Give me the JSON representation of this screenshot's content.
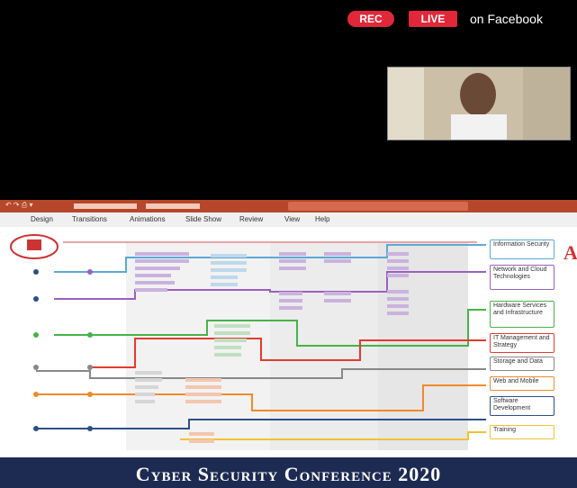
{
  "stream": {
    "rec_label": "REC",
    "live_label": "LIVE",
    "platform_label": "on Facebook"
  },
  "app": {
    "menu": [
      "Design",
      "Transitions",
      "Animations",
      "Slide Show",
      "Review",
      "View",
      "Help"
    ]
  },
  "slide": {
    "categories": [
      {
        "label": "Information Security",
        "color": "#5aa9d6"
      },
      {
        "label": "Network and Cloud Technologies",
        "color": "#9b5fc0"
      },
      {
        "label": "Hardware Services and Infrastructure",
        "color": "#46b34a"
      },
      {
        "label": "IT Management and Strategy",
        "color": "#e23b2e"
      },
      {
        "label": "Storage and Data",
        "color": "#888888"
      },
      {
        "label": "Web and Mobile",
        "color": "#f08a2a"
      },
      {
        "label": "Software Development",
        "color": "#2d4f86"
      },
      {
        "label": "Training",
        "color": "#f2c230"
      }
    ]
  },
  "banner": {
    "text": "Cyber Security Conference 2020"
  }
}
